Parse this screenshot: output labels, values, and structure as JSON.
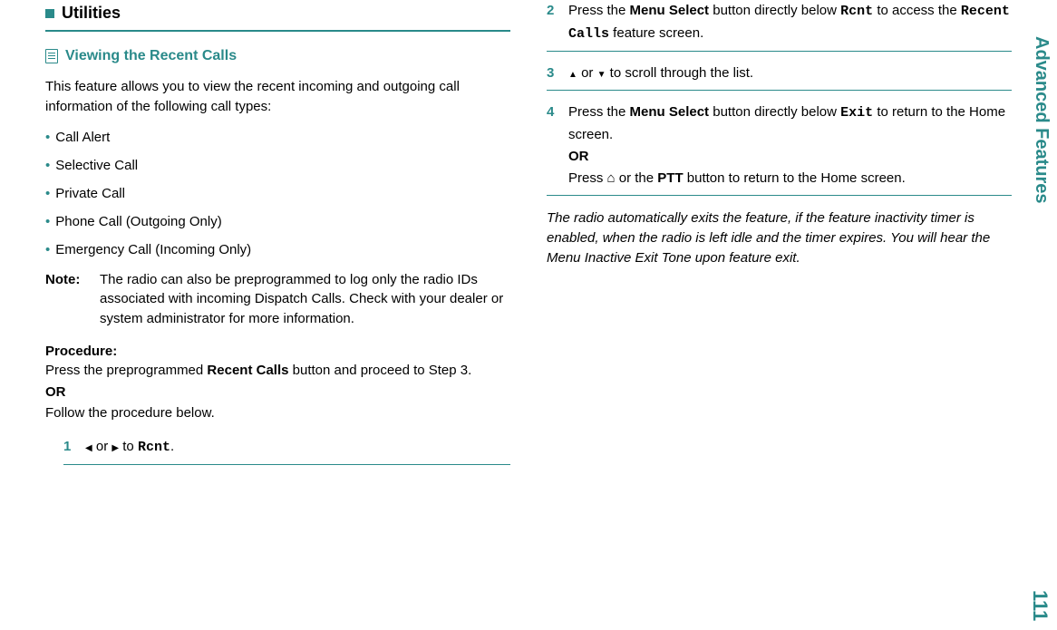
{
  "side_tab": "Advanced Features",
  "page_number": "111",
  "section": {
    "title": "Utilities"
  },
  "subsection": {
    "title": "Viewing the Recent Calls",
    "intro": "This feature allows you to view the recent incoming and outgoing call information of the following call types:",
    "bullets": [
      "Call Alert",
      "Selective Call",
      "Private Call",
      "Phone Call (Outgoing Only)",
      "Emergency Call (Incoming Only)"
    ],
    "note_label": "Note:",
    "note_body": "The radio can also be preprogrammed to log only the radio IDs associated with incoming Dispatch Calls. Check with your dealer or system administrator for more information.",
    "procedure_label": "Procedure:",
    "procedure_intro1": "Press the preprogrammed ",
    "procedure_intro1_bold": "Recent Calls",
    "procedure_intro1_tail": " button and proceed to Step 3.",
    "procedure_or": "OR",
    "procedure_intro2": "Follow the procedure below."
  },
  "steps": {
    "s1": {
      "num": "1",
      "or": " or ",
      "to": " to ",
      "code": "Rcnt",
      "period": "."
    },
    "s2": {
      "num": "2",
      "pre": "Press the ",
      "bold1": "Menu Select",
      "mid1": " button directly below ",
      "code1": "Rcnt",
      "mid2": " to access the ",
      "code2": "Recent Calls",
      "tail": " feature screen."
    },
    "s3": {
      "num": "3",
      "or": " or ",
      "tail": " to scroll through the list."
    },
    "s4": {
      "num": "4",
      "pre": "Press the ",
      "bold1": "Menu Select",
      "mid1": " button directly below ",
      "code1": "Exit",
      "mid2": " to return to the Home screen.",
      "or": "OR",
      "line2a": "Press ",
      "line2b": " or the ",
      "bold2": "PTT",
      "line2c": " button to return to the Home screen."
    }
  },
  "footnote": "The radio automatically exits the feature, if the feature inactivity timer is enabled, when the radio is left idle and the timer expires. You will hear the Menu Inactive Exit Tone upon feature exit."
}
